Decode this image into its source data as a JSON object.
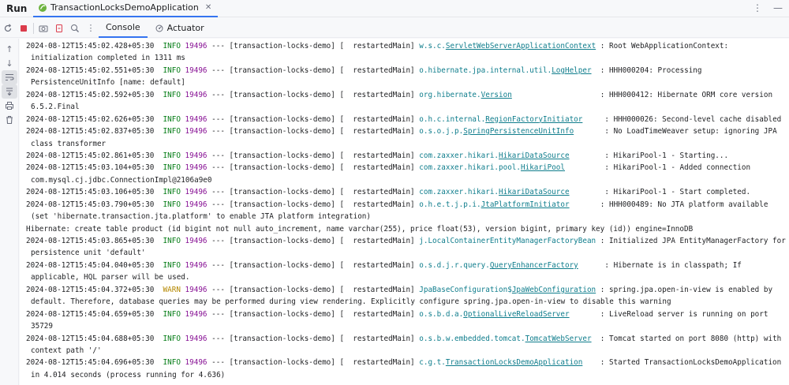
{
  "titlebar": {
    "run_label": "Run",
    "tab_label": "TransactionLocksDemoApplication"
  },
  "toolbar": {
    "console_tab": "Console",
    "actuator_tab": "Actuator"
  },
  "colors": {
    "accent": "#3574f0",
    "info": "#067d17",
    "warn": "#b58800",
    "pid": "#871094",
    "logger": "#0f7d8c"
  },
  "log_lines": [
    {
      "ts": "2024-08-12T15:45:02.428+05:30",
      "level": "INFO",
      "pid": "19496",
      "sep": "---",
      "app": "[transaction-locks-demo]",
      "thread": "[  restartedMain]",
      "logger_pre": "w.s.c.",
      "logger_link": "ServletWebServerApplicationContext",
      "logger_post": "",
      "pad": " ",
      "msg": ": Root WebApplicationContext:",
      "cont": "initialization completed in 1311 ms"
    },
    {
      "ts": "2024-08-12T15:45:02.551+05:30",
      "level": "INFO",
      "pid": "19496",
      "sep": "---",
      "app": "[transaction-locks-demo]",
      "thread": "[  restartedMain]",
      "logger_pre": "o.hibernate.jpa.internal.util.",
      "logger_link": "LogHelper",
      "logger_post": "",
      "pad": "  ",
      "msg": ": HHH000204: Processing",
      "cont": "PersistenceUnitInfo [name: default]"
    },
    {
      "ts": "2024-08-12T15:45:02.592+05:30",
      "level": "INFO",
      "pid": "19496",
      "sep": "---",
      "app": "[transaction-locks-demo]",
      "thread": "[  restartedMain]",
      "logger_pre": "org.hibernate.",
      "logger_link": "Version",
      "logger_post": "",
      "pad": "                    ",
      "msg": ": HHH000412: Hibernate ORM core version",
      "cont": "6.5.2.Final"
    },
    {
      "ts": "2024-08-12T15:45:02.626+05:30",
      "level": "INFO",
      "pid": "19496",
      "sep": "---",
      "app": "[transaction-locks-demo]",
      "thread": "[  restartedMain]",
      "logger_pre": "o.h.c.internal.",
      "logger_link": "RegionFactoryInitiator",
      "logger_post": "",
      "pad": "     ",
      "msg": ": HHH000026: Second-level cache disabled",
      "cont": ""
    },
    {
      "ts": "2024-08-12T15:45:02.837+05:30",
      "level": "INFO",
      "pid": "19496",
      "sep": "---",
      "app": "[transaction-locks-demo]",
      "thread": "[  restartedMain]",
      "logger_pre": "o.s.o.j.p.",
      "logger_link": "SpringPersistenceUnitInfo",
      "logger_post": "",
      "pad": "       ",
      "msg": ": No LoadTimeWeaver setup: ignoring JPA",
      "cont": "class transformer"
    },
    {
      "ts": "2024-08-12T15:45:02.861+05:30",
      "level": "INFO",
      "pid": "19496",
      "sep": "---",
      "app": "[transaction-locks-demo]",
      "thread": "[  restartedMain]",
      "logger_pre": "com.zaxxer.hikari.",
      "logger_link": "HikariDataSource",
      "logger_post": "",
      "pad": "        ",
      "msg": ": HikariPool-1 - Starting...",
      "cont": ""
    },
    {
      "ts": "2024-08-12T15:45:03.104+05:30",
      "level": "INFO",
      "pid": "19496",
      "sep": "---",
      "app": "[transaction-locks-demo]",
      "thread": "[  restartedMain]",
      "logger_pre": "com.zaxxer.hikari.pool.",
      "logger_link": "HikariPool",
      "logger_post": "",
      "pad": "         ",
      "msg": ": HikariPool-1 - Added connection",
      "cont": "com.mysql.cj.jdbc.ConnectionImpl@2106a9e0"
    },
    {
      "ts": "2024-08-12T15:45:03.106+05:30",
      "level": "INFO",
      "pid": "19496",
      "sep": "---",
      "app": "[transaction-locks-demo]",
      "thread": "[  restartedMain]",
      "logger_pre": "com.zaxxer.hikari.",
      "logger_link": "HikariDataSource",
      "logger_post": "",
      "pad": "        ",
      "msg": ": HikariPool-1 - Start completed.",
      "cont": ""
    },
    {
      "ts": "2024-08-12T15:45:03.790+05:30",
      "level": "INFO",
      "pid": "19496",
      "sep": "---",
      "app": "[transaction-locks-demo]",
      "thread": "[  restartedMain]",
      "logger_pre": "o.h.e.t.j.p.i.",
      "logger_link": "JtaPlatformInitiator",
      "logger_post": "",
      "pad": "       ",
      "msg": ": HHH000489: No JTA platform available",
      "cont": "(set 'hibernate.transaction.jta.platform' to enable JTA platform integration)"
    },
    {
      "raw": "Hibernate: create table product (id bigint not null auto_increment, name varchar(255), price float(53), version bigint, primary key (id)) engine=InnoDB"
    },
    {
      "ts": "2024-08-12T15:45:03.865+05:30",
      "level": "INFO",
      "pid": "19496",
      "sep": "---",
      "app": "[transaction-locks-demo]",
      "thread": "[  restartedMain]",
      "logger_pre": "j.LocalContainerEntityManagerFactoryBean",
      "logger_link": "",
      "logger_post": "",
      "pad": " ",
      "msg": ": Initialized JPA EntityManagerFactory for",
      "cont": "persistence unit 'default'"
    },
    {
      "ts": "2024-08-12T15:45:04.040+05:30",
      "level": "INFO",
      "pid": "19496",
      "sep": "---",
      "app": "[transaction-locks-demo]",
      "thread": "[  restartedMain]",
      "logger_pre": "o.s.d.j.r.query.",
      "logger_link": "QueryEnhancerFactory",
      "logger_post": "",
      "pad": "      ",
      "msg": ": Hibernate is in classpath; If",
      "cont": "applicable, HQL parser will be used."
    },
    {
      "ts": "2024-08-12T15:45:04.372+05:30",
      "level": "WARN",
      "pid": "19496",
      "sep": "---",
      "app": "[transaction-locks-demo]",
      "thread": "[  restartedMain]",
      "logger_pre": "JpaBaseConfiguration$",
      "logger_link": "JpaWebConfiguration",
      "logger_post": "",
      "pad": " ",
      "msg": ": spring.jpa.open-in-view is enabled by",
      "cont": "default. Therefore, database queries may be performed during view rendering. Explicitly configure spring.jpa.open-in-view to disable this warning"
    },
    {
      "ts": "2024-08-12T15:45:04.659+05:30",
      "level": "INFO",
      "pid": "19496",
      "sep": "---",
      "app": "[transaction-locks-demo]",
      "thread": "[  restartedMain]",
      "logger_pre": "o.s.b.d.a.",
      "logger_link": "OptionalLiveReloadServer",
      "logger_post": "",
      "pad": "       ",
      "msg": ": LiveReload server is running on port",
      "cont": "35729"
    },
    {
      "ts": "2024-08-12T15:45:04.688+05:30",
      "level": "INFO",
      "pid": "19496",
      "sep": "---",
      "app": "[transaction-locks-demo]",
      "thread": "[  restartedMain]",
      "logger_pre": "o.s.b.w.embedded.tomcat.",
      "logger_link": "TomcatWebServer",
      "logger_post": "",
      "pad": "  ",
      "msg": ": Tomcat started on port 8080 (http) with",
      "cont": "context path '/'"
    },
    {
      "ts": "2024-08-12T15:45:04.696+05:30",
      "level": "INFO",
      "pid": "19496",
      "sep": "---",
      "app": "[transaction-locks-demo]",
      "thread": "[  restartedMain]",
      "logger_pre": "c.g.t.",
      "logger_link": "TransactionLocksDemoApplication",
      "logger_post": "",
      "pad": "    ",
      "msg": ": Started TransactionLocksDemoApplication",
      "cont": "in 4.014 seconds (process running for 4.636)"
    }
  ]
}
